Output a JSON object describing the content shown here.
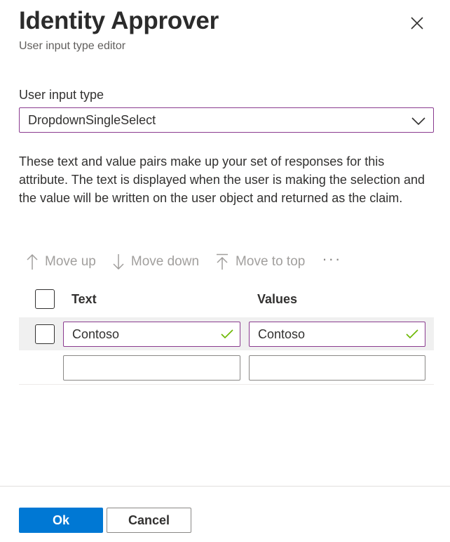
{
  "header": {
    "title": "Identity Approver",
    "subtitle": "User input type editor"
  },
  "input_type": {
    "label": "User input type",
    "selected": "DropdownSingleSelect"
  },
  "description": "These text and value pairs make up your set of responses for this attribute. The text is displayed when the user is making the selection and the value will be written on the user object and returned as the claim.",
  "toolbar": {
    "move_up": "Move up",
    "move_down": "Move down",
    "move_to_top": "Move to top",
    "more": "···"
  },
  "table": {
    "columns": [
      "Text",
      "Values"
    ],
    "rows": [
      {
        "text": "Contoso",
        "value": "Contoso",
        "valid": true
      },
      {
        "text": "",
        "value": "",
        "valid": false
      }
    ]
  },
  "footer": {
    "ok_label": "Ok",
    "cancel_label": "Cancel"
  },
  "icons": {
    "close": "close-icon",
    "chevron": "chevron-down-icon",
    "arrow_up": "arrow-up-icon",
    "arrow_down": "arrow-down-icon",
    "arrow_top": "arrow-to-top-icon",
    "check": "checkmark-icon"
  },
  "colors": {
    "accent": "#0078d4",
    "focus_border": "#8a3b8f",
    "valid_check": "#6bb700",
    "disabled_text": "#a19f9d"
  }
}
